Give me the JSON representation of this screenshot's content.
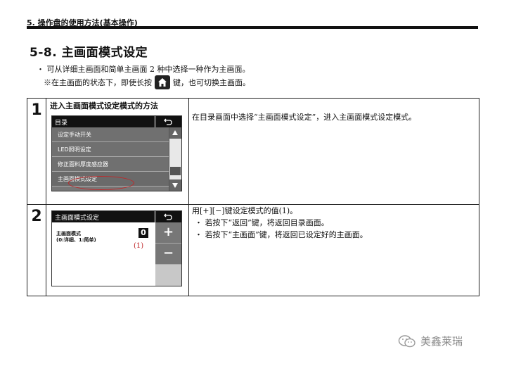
{
  "header": {
    "chapter": "5. 操作盘的使用方法(基本操作)"
  },
  "section": {
    "title": "5-8. 主画面模式设定"
  },
  "intro": {
    "line1": "・ 可从详细主画面和简单主画面 2 种中选择一种作为主画面。",
    "line2_before": "※在主画面的状态下，即使长按",
    "line2_after": "键，也可切换主画面。",
    "key_icon": "home-icon"
  },
  "steps": [
    {
      "number": "1",
      "label": "进入主画面模式设定模式的方法",
      "screen": {
        "title": "目录",
        "menu": [
          "设定手动开关",
          "LED照明设定",
          "修正面料厚度感应器",
          "主画面模式设定"
        ],
        "selected_index": 3
      },
      "description": "在目录画面中选择“主画面模式设定”，进入主画面模式设定模式。"
    },
    {
      "number": "2",
      "screen": {
        "title": "主画面模式设定",
        "field_label_1": "主画面模式",
        "field_label_2": "(0:详细、1:简单)",
        "value": "0",
        "callout": "(1)",
        "plus": "+",
        "minus": "−"
      },
      "description": {
        "line1": "用[+][−]键设定模式的值(1)。",
        "bullet1": "・ 若按下“返回”键，将返回目录画面。",
        "bullet2": "・ 若按下“主画面”键，将返回已设定好的主画面。"
      }
    }
  ],
  "watermark": {
    "text": "美鑫莱瑞",
    "icon": "wechat-icon"
  },
  "colors": {
    "accent_red": "#c0282a",
    "screen_gray": "#777777"
  }
}
